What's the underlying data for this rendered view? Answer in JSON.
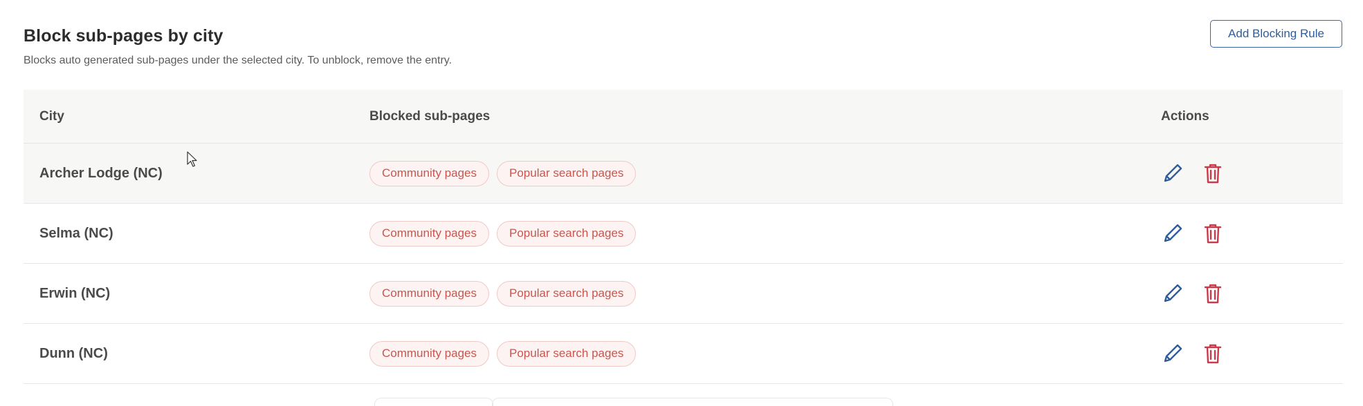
{
  "section": {
    "title": "Block sub-pages by city",
    "subtitle": "Blocks auto generated sub-pages under the selected city. To unblock, remove the entry.",
    "add_button_label": "Add Blocking Rule"
  },
  "table": {
    "columns": [
      "City",
      "Blocked sub-pages",
      "Actions"
    ],
    "rows": [
      {
        "city": "Archer Lodge (NC)",
        "blocked": [
          "Community pages",
          "Popular search pages"
        ]
      },
      {
        "city": "Selma (NC)",
        "blocked": [
          "Community pages",
          "Popular search pages"
        ]
      },
      {
        "city": "Erwin (NC)",
        "blocked": [
          "Community pages",
          "Popular search pages"
        ]
      },
      {
        "city": "Dunn (NC)",
        "blocked": [
          "Community pages",
          "Popular search pages"
        ]
      }
    ]
  },
  "colors": {
    "accent_blue": "#2f5d9c",
    "chip_text": "#c9564e",
    "chip_border": "#efc9c6",
    "delete_red": "#c93a4a"
  },
  "icons": {
    "edit": "pencil-icon",
    "delete": "trash-icon",
    "pointer": "mouse-cursor-icon"
  }
}
